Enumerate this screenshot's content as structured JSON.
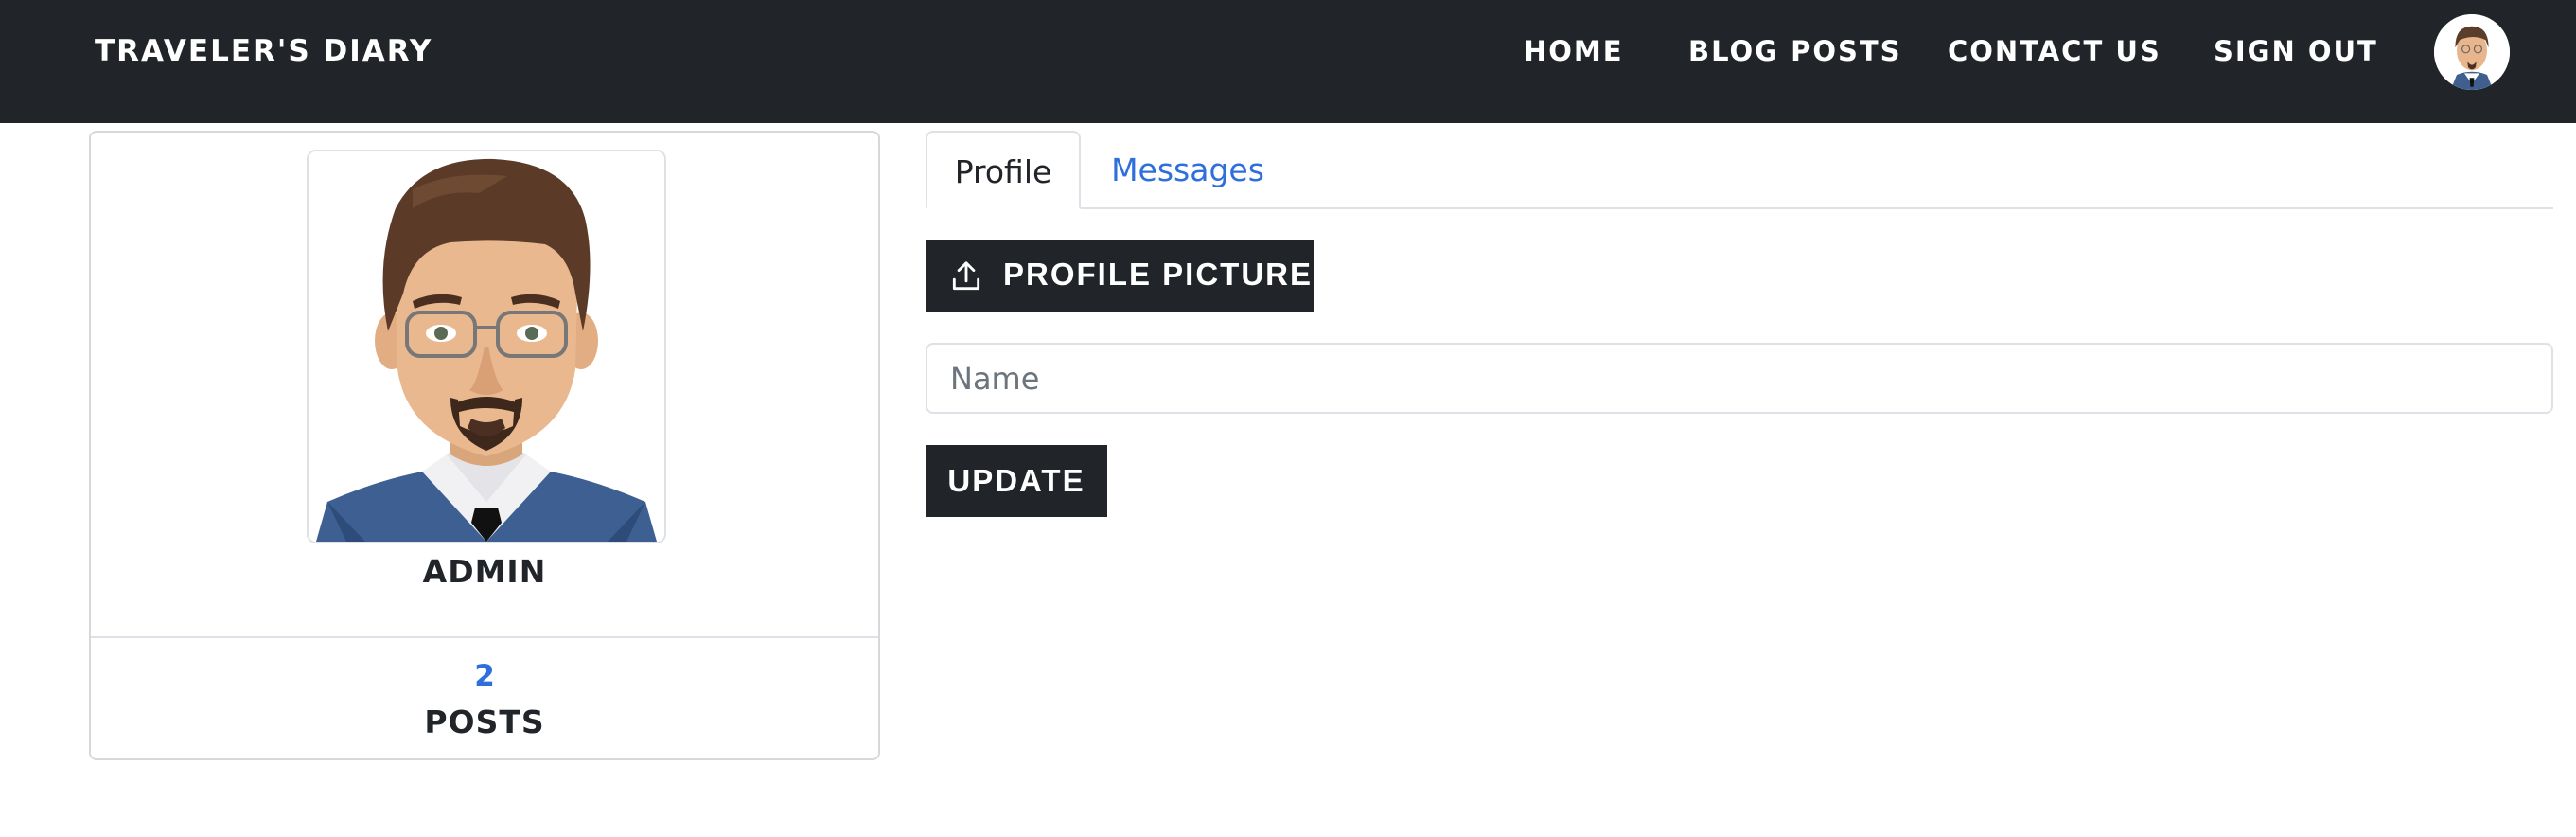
{
  "navbar": {
    "brand": "TRAVELER'S DIARY",
    "links": [
      "HOME",
      "BLOG POSTS",
      "CONTACT US",
      "SIGN OUT"
    ],
    "avatar_icon": "user-avatar-icon"
  },
  "profile_card": {
    "avatar_icon": "user-avatar-icon",
    "username": "ADMIN",
    "post_count": "2",
    "post_label": "POSTS"
  },
  "tabs": [
    {
      "label": "Profile",
      "active": true
    },
    {
      "label": "Messages",
      "active": false
    }
  ],
  "form": {
    "upload_icon": "upload-icon",
    "upload_label": "PROFILE PICTURE",
    "name_placeholder": "Name",
    "name_value": "",
    "update_label": "UPDATE"
  },
  "colors": {
    "navbar_bg": "#212529",
    "link_blue": "#2f6fdc",
    "border": "#dee2e6"
  }
}
